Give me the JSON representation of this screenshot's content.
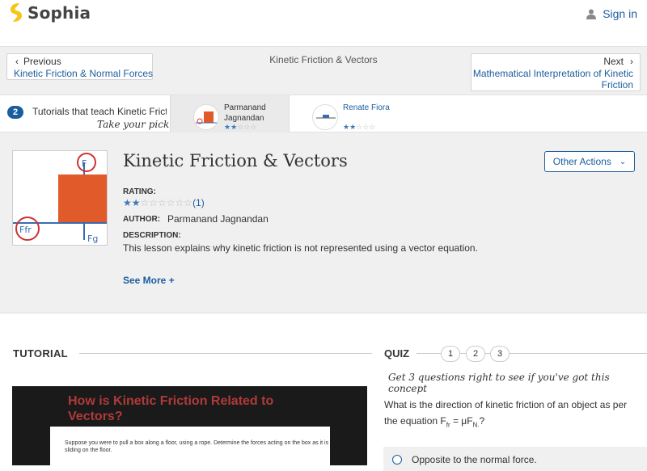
{
  "header": {
    "brand": "Sophia",
    "signin_label": "Sign in",
    "brand_color": "#f5c518",
    "link_color": "#1b5e9e"
  },
  "nav": {
    "prev_label": "Previous",
    "prev_link": "Kinetic Friction & Normal Forces",
    "title": "Kinetic Friction & Vectors",
    "next_label": "Next",
    "next_link": "Mathematical Interpretation of Kinetic Friction"
  },
  "strip": {
    "count": "2",
    "text": "Tutorials that teach Kinetic Frict",
    "pick": "Take your pick:",
    "tutorials": [
      {
        "name_line1": "Parmanand",
        "name_line2": "Jagnandan",
        "stars_filled": "★★",
        "stars_empty": "☆☆☆",
        "rating": 2.5
      },
      {
        "name_line1": "Renate Fiora",
        "stars_filled": "★★",
        "stars_empty": "☆☆☆",
        "rating": 2
      }
    ]
  },
  "lesson": {
    "title": "Kinetic Friction & Vectors",
    "other_actions": "Other Actions",
    "rating_label": "RATING:",
    "stars_filled": "★★",
    "stars_empty": "☆☆☆☆☆☆",
    "rating_count": "(1)",
    "author_label": "AUTHOR:",
    "author": "Parmanand Jagnandan",
    "description_label": "DESCRIPTION:",
    "description": "This lesson explains why kinetic friction is not represented using a vector equation.",
    "see_more": "See More +"
  },
  "tutorial": {
    "header": "TUTORIAL",
    "video_title": "How is Kinetic Friction Related to Vectors?",
    "video_text": "Suppose you were to pull a box along a floor, using a rope. Determine the forces acting on the box as it is sliding on the floor."
  },
  "quiz": {
    "header": "QUIZ",
    "numbers": [
      "1",
      "2",
      "3"
    ],
    "tagline": "Get 3 questions right to see if you've got this concept",
    "question_pre": "What is the direction of kinetic friction of an object as per the equation F",
    "question_sub1": "fr",
    "question_mid": " = μF",
    "question_sub2": "N.",
    "question_post": "?",
    "answer1": "Opposite to the normal force."
  }
}
